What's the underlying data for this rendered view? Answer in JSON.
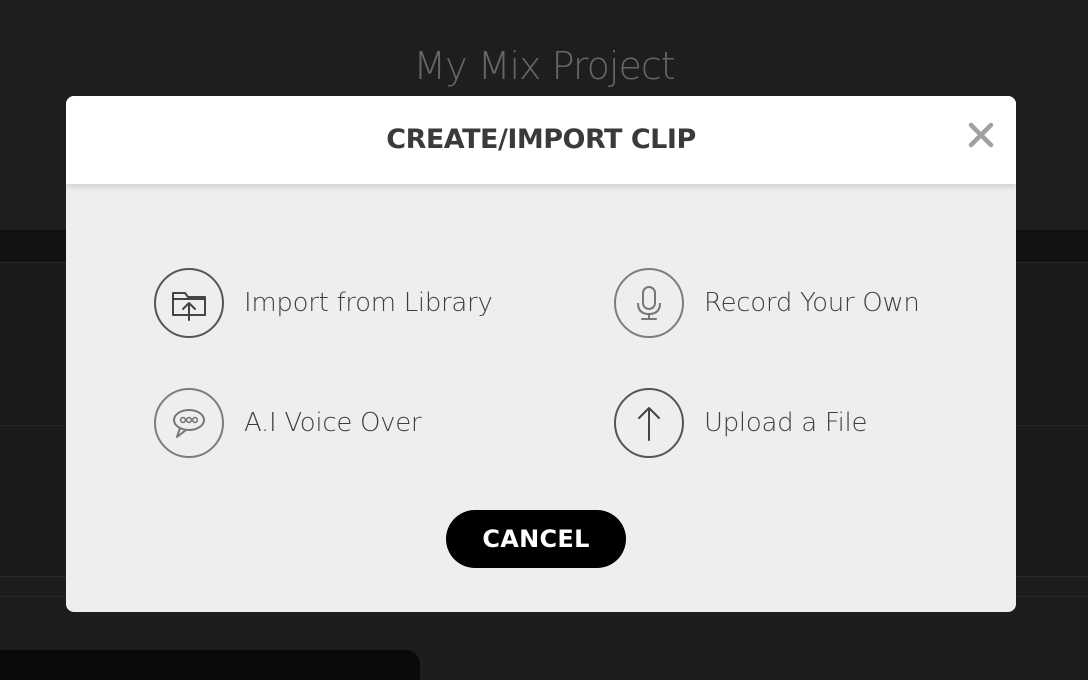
{
  "background": {
    "project_title": "My Mix Project"
  },
  "modal": {
    "title": "CREATE/IMPORT CLIP",
    "close_glyph": "✕",
    "options": [
      {
        "label": "Import from Library",
        "icon": "folder-upload-icon"
      },
      {
        "label": "Record Your Own",
        "icon": "microphone-icon"
      },
      {
        "label": "A.I Voice Over",
        "icon": "speech-bubble-icon"
      },
      {
        "label": "Upload a File",
        "icon": "upload-arrow-icon"
      }
    ],
    "cancel_label": "CANCEL"
  },
  "colors": {
    "modal_background": "#eeeeee",
    "header_background": "#ffffff",
    "cancel_button": "#000000",
    "app_background": "#1e1e1e"
  }
}
